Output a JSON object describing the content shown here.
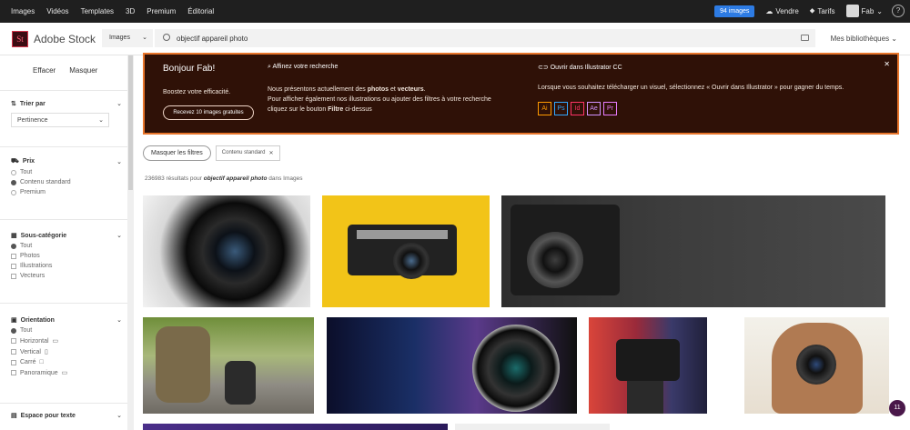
{
  "topnav": {
    "items": [
      "Images",
      "Vidéos",
      "Templates",
      "3D",
      "Premium",
      "Éditorial"
    ],
    "images_badge": "94 images",
    "sell": "Vendre",
    "pricing": "Tarifs",
    "user": "Fab"
  },
  "header": {
    "logo": "St",
    "brand": "Adobe Stock",
    "scope": "Images",
    "search_value": "objectif appareil photo",
    "libraries": "Mes bibliothèques"
  },
  "sidebar": {
    "clear": "Effacer",
    "hide": "Masquer",
    "sort_title": "Trier par",
    "sort_value": "Pertinence",
    "price_title": "Prix",
    "price_options": [
      "Tout",
      "Contenu standard",
      "Premium"
    ],
    "subcat_title": "Sous-catégorie",
    "subcat_options": [
      "Tout",
      "Photos",
      "Illustrations",
      "Vecteurs"
    ],
    "orient_title": "Orientation",
    "orient_options": [
      "Tout",
      "Horizontal",
      "Vertical",
      "Carré",
      "Panoramique"
    ],
    "space_title": "Espace pour texte"
  },
  "banner": {
    "hello": "Bonjour Fab!",
    "boost": "Boostez votre efficacité.",
    "cta": "Recevez 10 images gratuites",
    "refine_title": "Affinez votre recherche",
    "refine_line1a": "Nous présentons actuellement des ",
    "refine_bold1": "photos",
    "refine_and": " et ",
    "refine_bold2": "vecteurs",
    "refine_line2": "Pour afficher également nos illustrations ou ajouter des filtres à votre recherche",
    "refine_line3a": "cliquez sur le bouton ",
    "refine_bold3": "Filtre",
    "refine_line3b": " ci-dessus",
    "illus_title": "Ouvrir dans Illustrator CC",
    "illus_text": "Lorsque vous souhaitez télécharger un visuel, sélectionnez « Ouvrir dans Illustrator » pour gagner du temps.",
    "apps": [
      "Ai",
      "Ps",
      "Id",
      "Ae",
      "Pr"
    ],
    "app_colors": [
      "#ff9a00",
      "#31a8ff",
      "#ff3366",
      "#d291ff",
      "#e77bff"
    ]
  },
  "filters": {
    "hide_filters": "Masquer les filtres",
    "chip": "Contenu standard"
  },
  "results": {
    "count": "236983",
    "prefix": "résultats pour",
    "query": "objectif appareil photo",
    "suffix": "dans Images"
  },
  "notification_count": "11"
}
